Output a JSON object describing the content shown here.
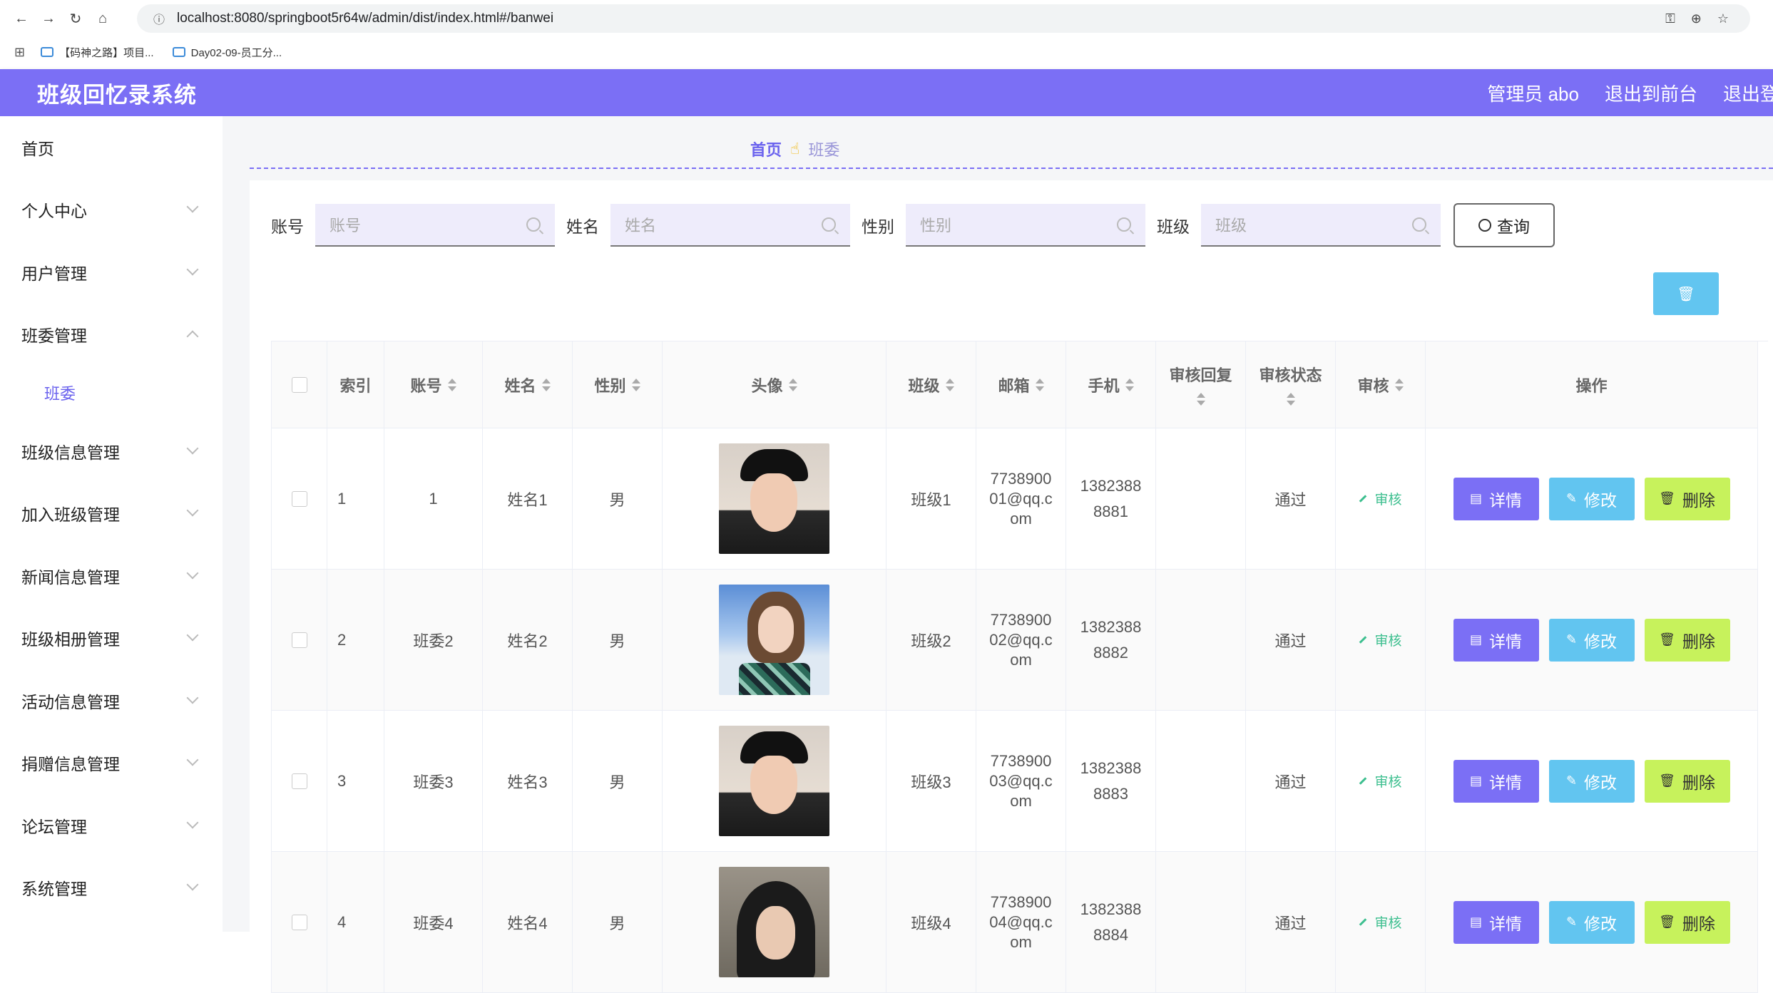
{
  "browser": {
    "url": "localhost:8080/springboot5r64w/admin/dist/index.html#/banwei",
    "bookmarks": [
      "【码神之路】项目...",
      "Day02-09-员工分..."
    ]
  },
  "header": {
    "title": "班级回忆录系统",
    "links": [
      "管理员 abo",
      "退出到前台",
      "退出登录"
    ]
  },
  "sidebar": {
    "items": [
      {
        "label": "首页",
        "chevron": ""
      },
      {
        "label": "个人中心",
        "chevron": "down"
      },
      {
        "label": "用户管理",
        "chevron": "down"
      },
      {
        "label": "班委管理",
        "chevron": "up"
      },
      {
        "label": "班级信息管理",
        "chevron": "down"
      },
      {
        "label": "加入班级管理",
        "chevron": "down"
      },
      {
        "label": "新闻信息管理",
        "chevron": "down"
      },
      {
        "label": "班级相册管理",
        "chevron": "down"
      },
      {
        "label": "活动信息管理",
        "chevron": "down"
      },
      {
        "label": "捐赠信息管理",
        "chevron": "down"
      },
      {
        "label": "论坛管理",
        "chevron": "down"
      },
      {
        "label": "系统管理",
        "chevron": "down"
      }
    ],
    "subitem": "班委"
  },
  "breadcrumb": {
    "home": "首页",
    "current": "班委"
  },
  "search": {
    "fields": [
      {
        "label": "账号",
        "placeholder": "账号"
      },
      {
        "label": "姓名",
        "placeholder": "姓名"
      },
      {
        "label": "性别",
        "placeholder": "性别"
      },
      {
        "label": "班级",
        "placeholder": "班级"
      }
    ],
    "query_label": "查询"
  },
  "table": {
    "headers": [
      "索引",
      "账号",
      "姓名",
      "性别",
      "头像",
      "班级",
      "邮箱",
      "手机",
      "审核回复",
      "审核状态",
      "审核",
      "操作"
    ],
    "rows": [
      {
        "index": "1",
        "account": "1",
        "name": "姓名1",
        "gender": "男",
        "avatar": "male-cap",
        "class": "班级1",
        "email": [
          "7738900",
          "01@qq.c",
          "om"
        ],
        "phone": [
          "1382388",
          "8881"
        ],
        "reply": "",
        "status": "通过",
        "audit": "审核"
      },
      {
        "index": "2",
        "account": "班委2",
        "name": "姓名2",
        "gender": "男",
        "avatar": "female-sky",
        "class": "班级2",
        "email": [
          "7738900",
          "02@qq.c",
          "om"
        ],
        "phone": [
          "1382388",
          "8882"
        ],
        "reply": "",
        "status": "通过",
        "audit": "审核"
      },
      {
        "index": "3",
        "account": "班委3",
        "name": "姓名3",
        "gender": "男",
        "avatar": "male-cap",
        "class": "班级3",
        "email": [
          "7738900",
          "03@qq.c",
          "om"
        ],
        "phone": [
          "1382388",
          "8883"
        ],
        "reply": "",
        "status": "通过",
        "audit": "审核"
      },
      {
        "index": "4",
        "account": "班委4",
        "name": "姓名4",
        "gender": "男",
        "avatar": "female-dark",
        "class": "班级4",
        "email": [
          "7738900",
          "04@qq.c",
          "om"
        ],
        "phone": [
          "1382388",
          "8884"
        ],
        "reply": "",
        "status": "通过",
        "audit": "审核"
      }
    ],
    "actions": {
      "detail": "详情",
      "edit": "修改",
      "delete": "删除"
    }
  },
  "colors": {
    "primary": "#7b6ff5",
    "info": "#62c5f0",
    "danger_lime": "#c7f25c",
    "success": "#3dbf8f"
  }
}
